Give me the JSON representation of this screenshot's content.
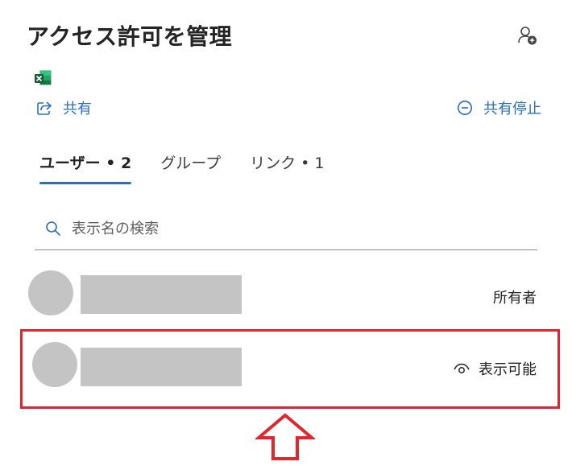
{
  "header": {
    "title": "アクセス許可を管理"
  },
  "file": {
    "icon": "excel-icon"
  },
  "actions": {
    "share_label": "共有",
    "stop_share_label": "共有停止"
  },
  "tabs": [
    {
      "label": "ユーザー • 2",
      "active": true
    },
    {
      "label": "グループ",
      "active": false
    },
    {
      "label": "リンク • 1",
      "active": false
    }
  ],
  "search": {
    "placeholder": "表示名の検索",
    "value": ""
  },
  "users": [
    {
      "name": "",
      "role": "所有者"
    },
    {
      "name": "",
      "role": "表示可能"
    }
  ],
  "colors": {
    "accent": "#2a6fbe",
    "highlight": "#e3262d",
    "redaction": "#c4c4c4"
  }
}
